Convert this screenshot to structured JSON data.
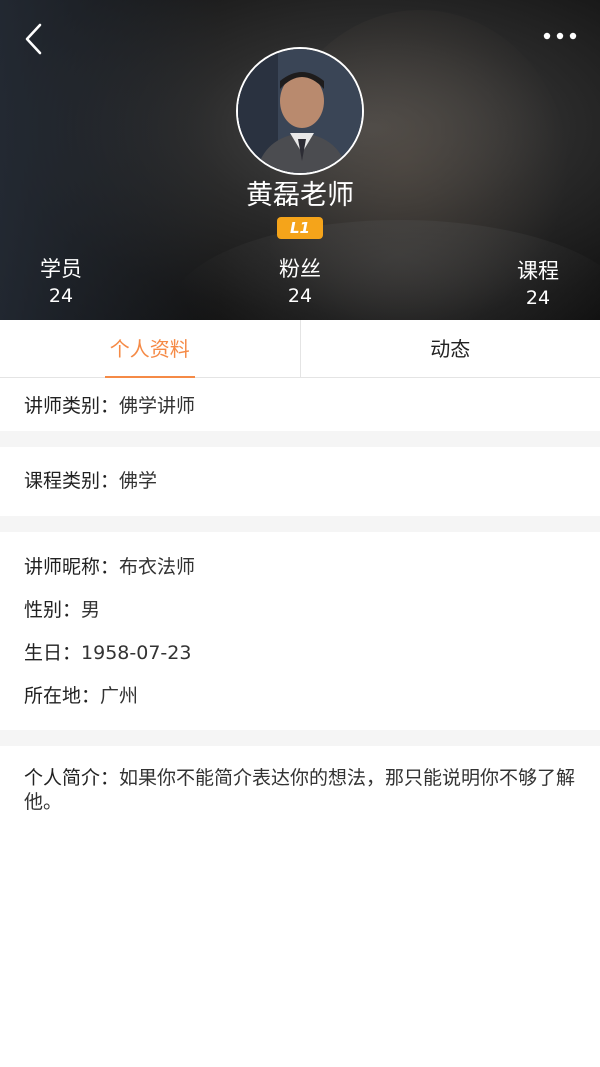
{
  "header": {
    "teacher_name": "黄磊老师",
    "level": "L1",
    "stats": [
      {
        "label": "学员",
        "value": "24"
      },
      {
        "label": "粉丝",
        "value": "24"
      },
      {
        "label": "课程",
        "value": "24"
      }
    ]
  },
  "tabs": [
    {
      "label": "个人资料",
      "active": true
    },
    {
      "label": "动态",
      "active": false
    }
  ],
  "profile": {
    "teacher_type": {
      "label": "讲师类别：",
      "value": "佛学讲师"
    },
    "course_type": {
      "label": "课程类别：",
      "value": "佛学"
    },
    "nickname": {
      "label": "讲师昵称：",
      "value": "布衣法师"
    },
    "gender": {
      "label": "性别：",
      "value": "男"
    },
    "birthday": {
      "label": "生日：",
      "value": "1958-07-23"
    },
    "location": {
      "label": "所在地：",
      "value": "广州"
    },
    "intro": {
      "label": "个人简介：",
      "value": "如果你不能简介表达你的想法，那只能说明你不够了解他。"
    }
  },
  "colors": {
    "accent": "#f58a46",
    "badge": "#f5a41a",
    "divider": "#f5f5f5"
  },
  "icons": {
    "back": "chevron-left-icon",
    "more": "more-horizontal-icon"
  }
}
